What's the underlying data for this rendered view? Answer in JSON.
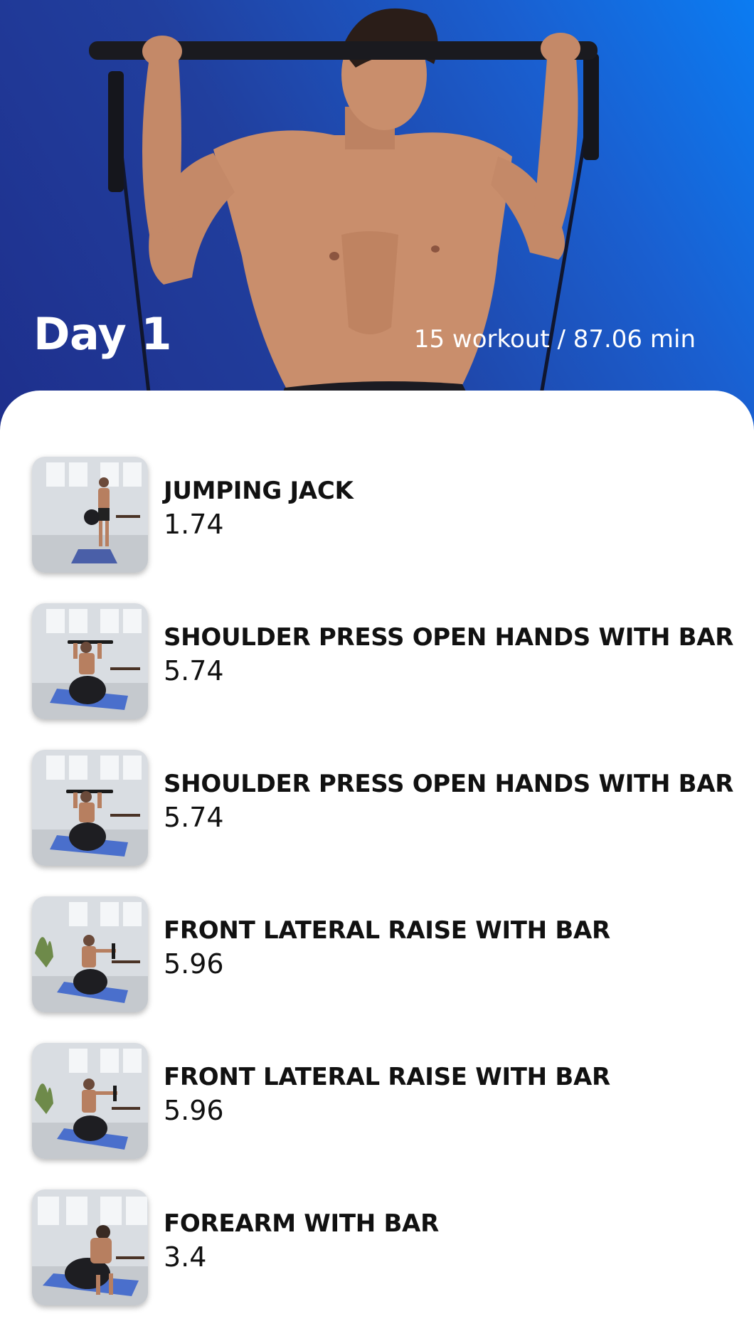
{
  "hero": {
    "title": "Day 1",
    "stats": "15 workout / 87.06 min"
  },
  "colors": {
    "hero_gradient_start": "#1e2f8c",
    "hero_gradient_end": "#0b7cf2",
    "text_primary": "#111111",
    "text_on_hero": "#ffffff"
  },
  "exercises": [
    {
      "name": "JUMPING JACK",
      "duration": "1.74"
    },
    {
      "name": "SHOULDER PRESS OPEN HANDS WITH BAR",
      "duration": "5.74"
    },
    {
      "name": "SHOULDER PRESS OPEN HANDS WITH BAR",
      "duration": "5.74"
    },
    {
      "name": "FRONT LATERAL RAISE WITH BAR",
      "duration": "5.96"
    },
    {
      "name": "FRONT LATERAL RAISE WITH BAR",
      "duration": "5.96"
    },
    {
      "name": "FOREARM WITH BAR",
      "duration": "3.4"
    }
  ]
}
